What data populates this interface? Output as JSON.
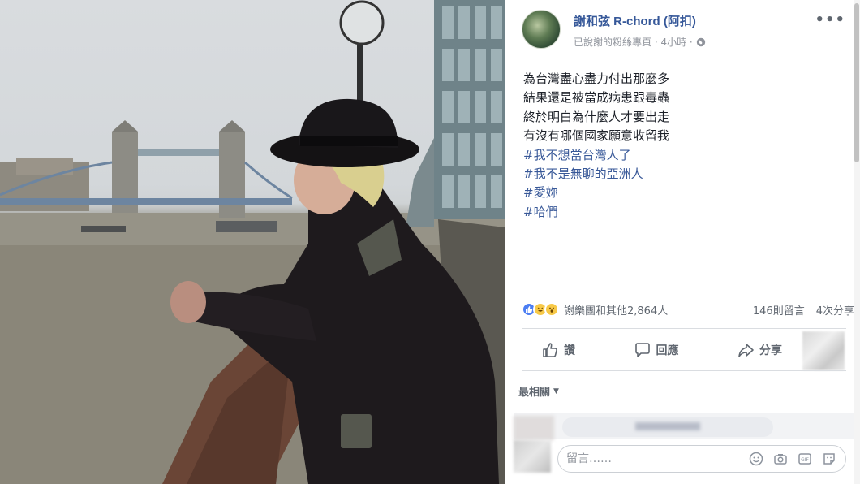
{
  "post": {
    "author": "謝和弦 R-chord (阿扣)",
    "meta_text": "已說謝的粉絲專頁 · 4小時 ·",
    "more_label": "•••",
    "lines": [
      "為台灣盡心盡力付出那麼多",
      "結果還是被當成病患跟毒蟲",
      "終於明白為什麼人才要出走",
      "有沒有哪個國家願意收留我"
    ],
    "hashtags": [
      "#我不想當台灣人了",
      "#我不是無聊的亞洲人",
      "#愛妳",
      "#哈們"
    ]
  },
  "reactions": {
    "names_text": "謝樂團和其他2,864人",
    "comments_text": "146則留言",
    "shares_text": "4次分享"
  },
  "actions": {
    "like_label": "讚",
    "comment_label": "回應",
    "share_label": "分享"
  },
  "sort": {
    "label": "最相關"
  },
  "composer": {
    "placeholder": "留言……"
  },
  "colors": {
    "link": "#365899",
    "hashtag": "#385898",
    "secondary_text": "#90949c"
  }
}
